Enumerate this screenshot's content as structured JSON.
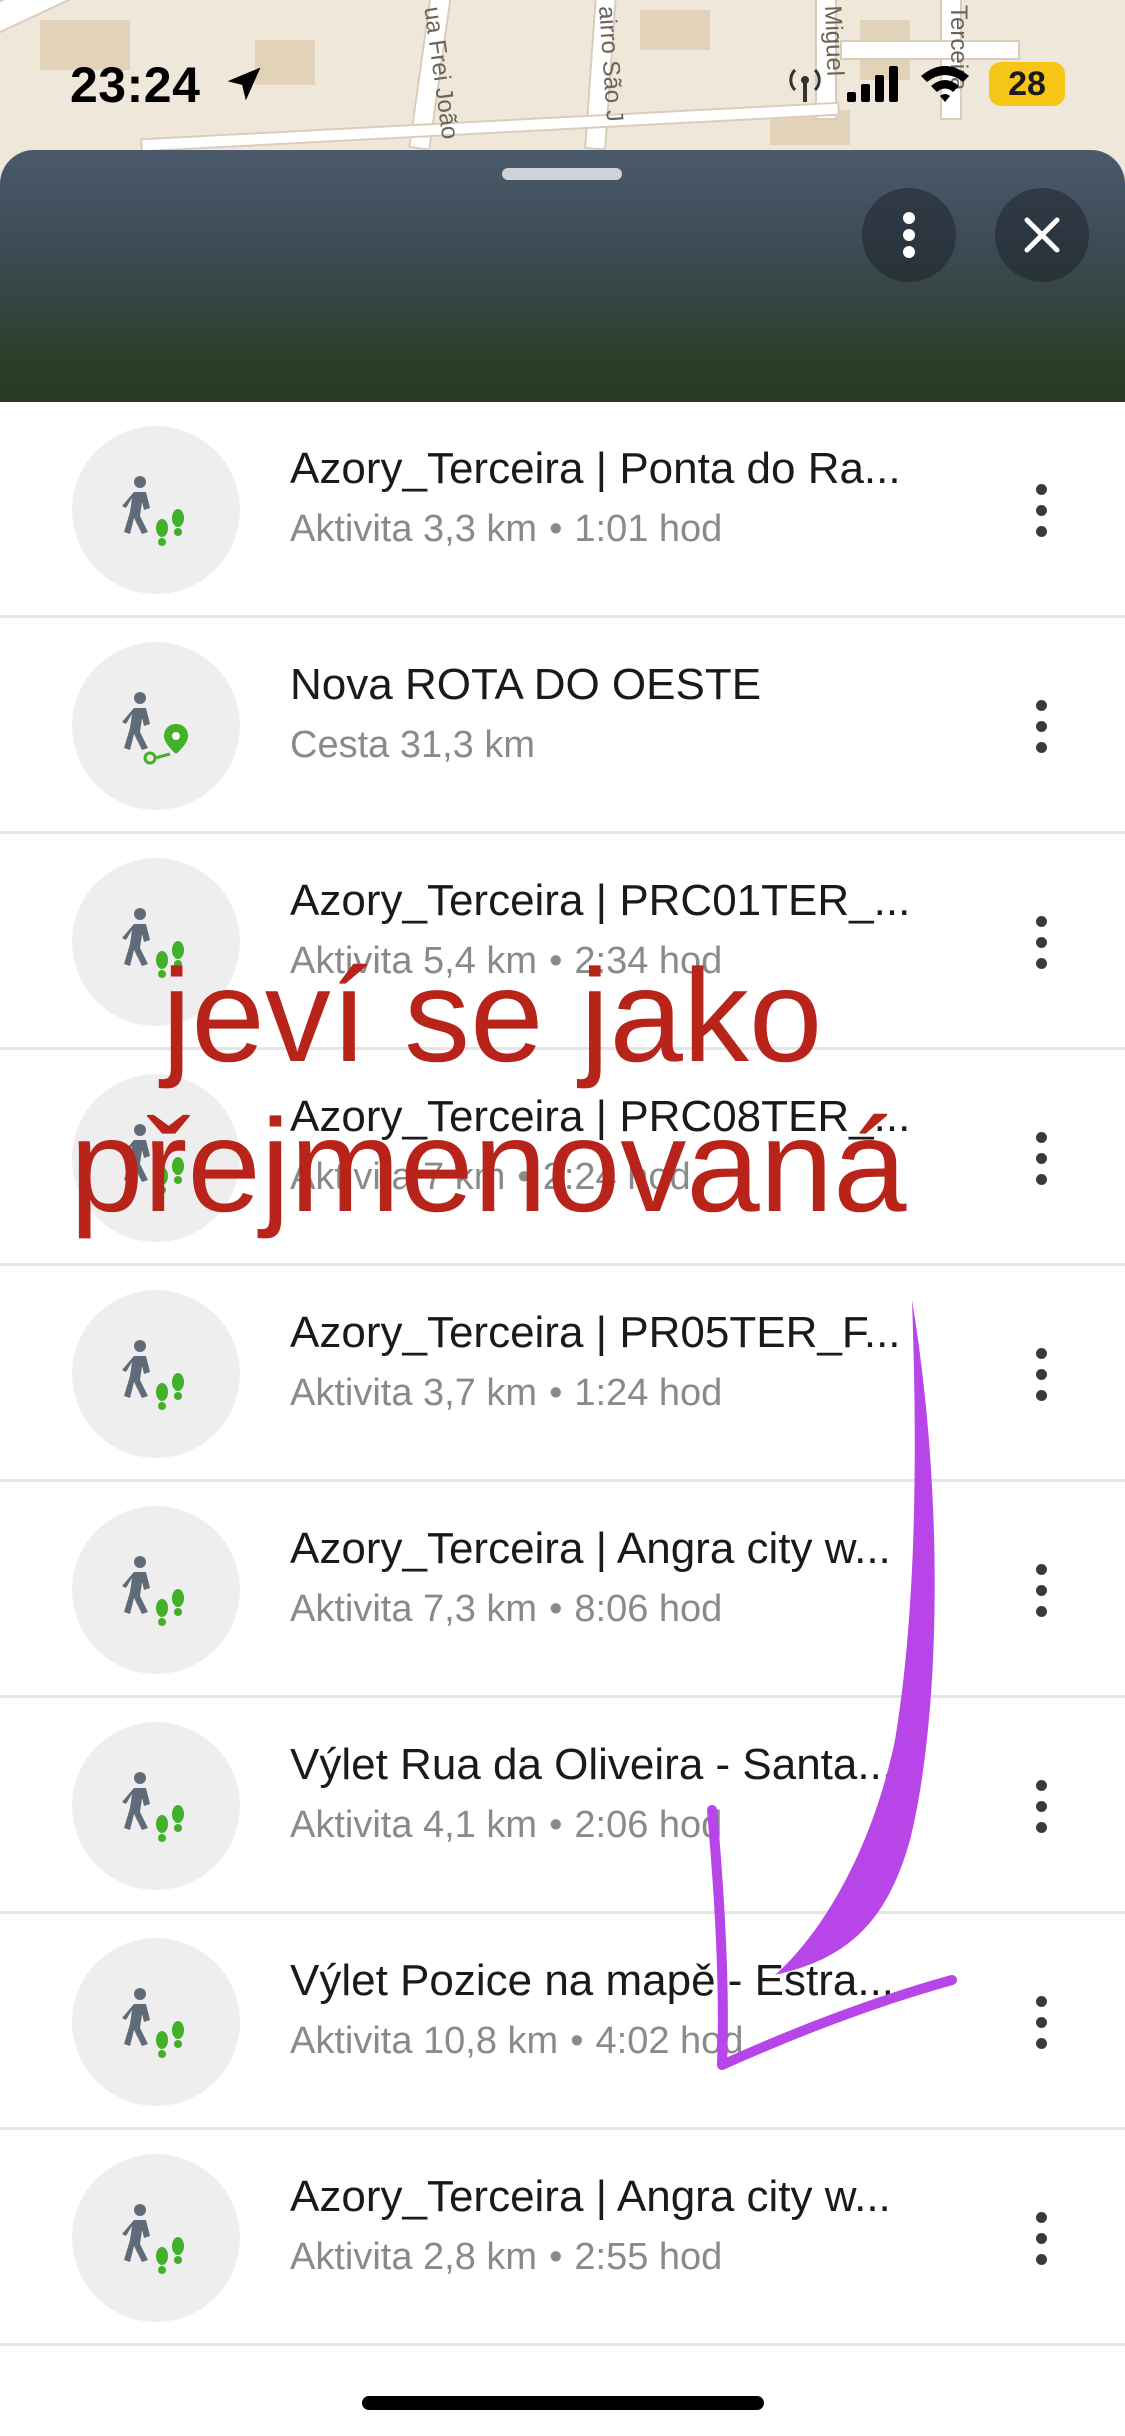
{
  "map": {
    "streets": [
      "ua Frei João",
      "airro São J",
      "Miguel",
      "Terceira"
    ]
  },
  "status_bar": {
    "time": "23:24",
    "battery": "28",
    "icons": [
      "location-arrow-icon",
      "hotspot-icon",
      "signal-icon",
      "wifi-icon"
    ]
  },
  "sheet": {
    "more_icon": "more-vertical-icon",
    "close_icon": "close-icon"
  },
  "items": [
    {
      "title": "Azory_Terceira | Ponta do Ra...",
      "type": "Aktivita 3,3 km",
      "duration": "1:01 hod",
      "icon": "hiking-activity-icon"
    },
    {
      "title": "Nova ROTA DO OESTE",
      "type": "Cesta 31,3 km",
      "duration": "",
      "icon": "route-icon"
    },
    {
      "title": "Azory_Terceira | PRC01TER_...",
      "type": "Aktivita 5,4 km",
      "duration": "2:34 hod",
      "icon": "hiking-activity-icon"
    },
    {
      "title": "Azory_Terceira | PRC08TER_...",
      "type": "Aktivita 7 km",
      "duration": "2:24 hod",
      "icon": "hiking-activity-icon"
    },
    {
      "title": "Azory_Terceira | PR05TER_F...",
      "type": "Aktivita 3,7 km",
      "duration": "1:24 hod",
      "icon": "hiking-activity-icon"
    },
    {
      "title": "Azory_Terceira | Angra city w...",
      "type": "Aktivita 7,3 km",
      "duration": "8:06 hod",
      "icon": "hiking-activity-icon"
    },
    {
      "title": "Výlet Rua da Oliveira - Santa...",
      "type": "Aktivita 4,1 km",
      "duration": "2:06 hod",
      "icon": "hiking-activity-icon"
    },
    {
      "title": "Výlet Pozice na mapě - Estra...",
      "type": "Aktivita 10,8 km",
      "duration": "4:02 hod",
      "icon": "hiking-activity-icon"
    },
    {
      "title": "Azory_Terceira | Angra city w...",
      "type": "Aktivita 2,8 km",
      "duration": "2:55 hod",
      "icon": "hiking-activity-icon"
    }
  ],
  "annotation": {
    "line1": "jeví se jako",
    "line2": "přejmenovaná",
    "color": "#b8241a",
    "arrow_color": "#b845e8"
  }
}
